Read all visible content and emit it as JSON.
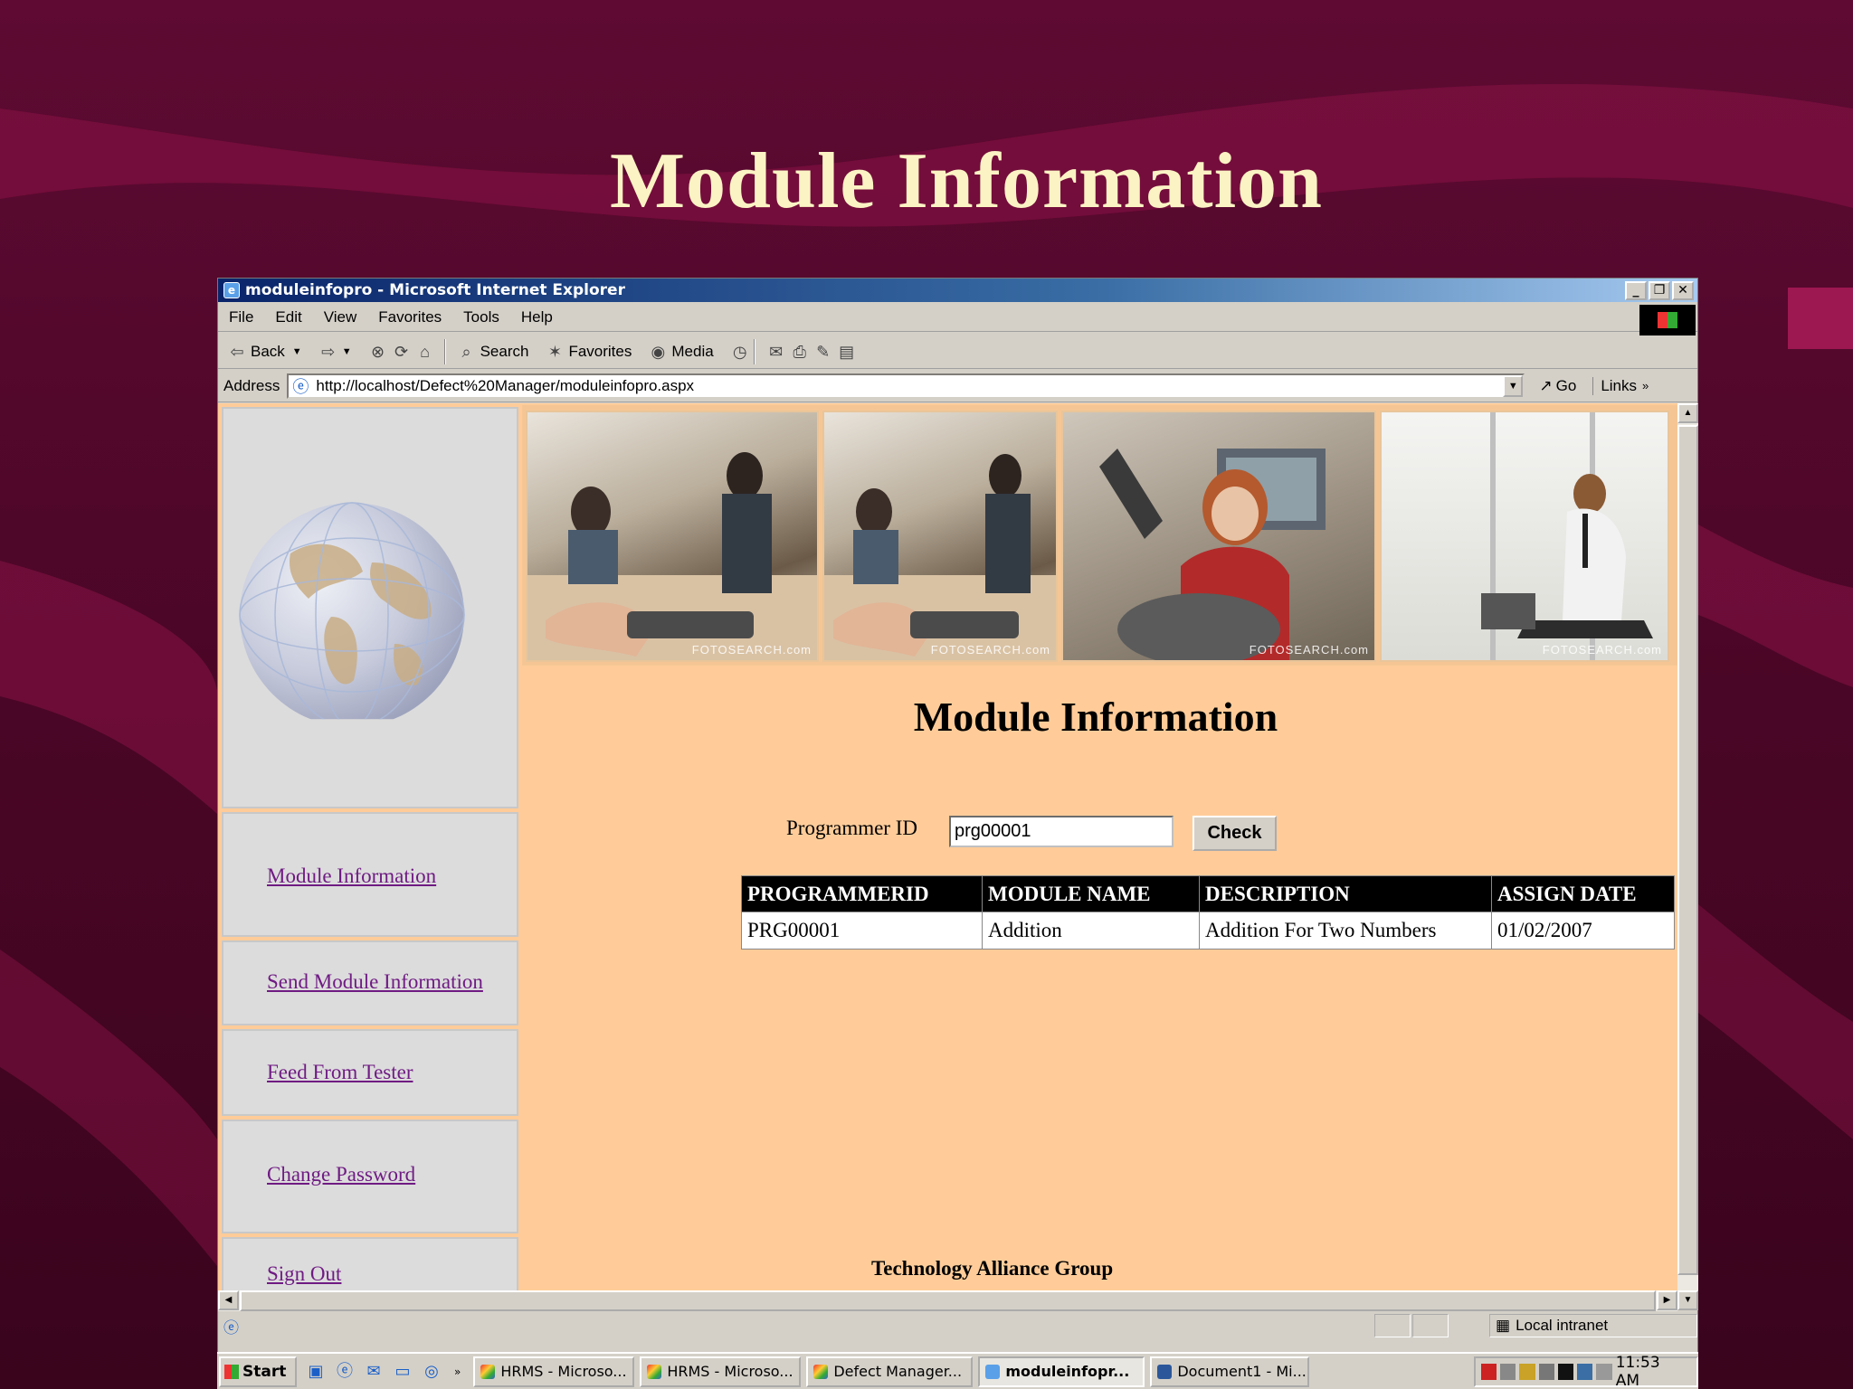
{
  "slide": {
    "title": "Module Information"
  },
  "window": {
    "title": "moduleinfopro - Microsoft Internet Explorer",
    "controls": {
      "minimize": "_",
      "restore": "❐",
      "close": "✕"
    }
  },
  "menu": [
    "File",
    "Edit",
    "View",
    "Favorites",
    "Tools",
    "Help"
  ],
  "toolbar": {
    "back": "Back",
    "search": "Search",
    "favorites": "Favorites",
    "media": "Media"
  },
  "address": {
    "label": "Address",
    "url": "http://localhost/Defect%20Manager/moduleinfopro.aspx",
    "go": "Go",
    "links": "Links"
  },
  "nav": {
    "items": [
      "Module Information",
      "Send Module Information",
      "Feed From Tester",
      "Change Password",
      "Sign Out"
    ]
  },
  "banner": {
    "watermark": "FOTOSEARCH.com"
  },
  "page": {
    "heading": "Module Information",
    "programmer_label": "Programmer ID",
    "programmer_value": "prg00001",
    "check_button": "Check",
    "table": {
      "headers": [
        "PROGRAMMERID",
        "MODULE NAME",
        "DESCRIPTION",
        "ASSIGN DATE"
      ],
      "rows": [
        [
          "PRG00001",
          "Addition",
          "Addition For Two Numbers",
          "01/02/2007"
        ]
      ]
    },
    "footer": "Technology Alliance Group"
  },
  "statusbar": {
    "zone": "Local intranet"
  },
  "taskbar": {
    "start": "Start",
    "tasks": [
      "HRMS - Microso...",
      "HRMS - Microso...",
      "Defect Manager...",
      "moduleinfopr...",
      "Document1 - Mi..."
    ],
    "active_task": "moduleinfopr...",
    "clock": "11:53 AM"
  },
  "colors": {
    "slide_background": "#4a0626",
    "slide_title": "#fbf3c4",
    "page_background": "#ffcc99",
    "nav_link": "#6f1b83",
    "table_header": "#000000"
  }
}
